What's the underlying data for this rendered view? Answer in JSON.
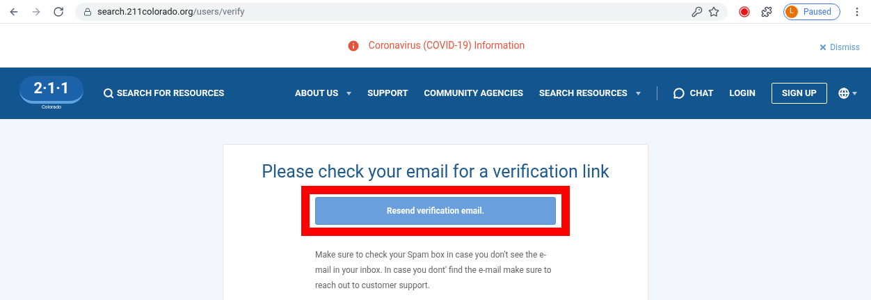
{
  "browser": {
    "url_host": "search.211colorado.org",
    "url_path": "/users/verify",
    "profile_initial": "L",
    "profile_status": "Paused"
  },
  "alert": {
    "text": "Coronavirus (COVID-19) Information",
    "dismiss": "Dismiss"
  },
  "nav": {
    "logo_text": "2·1·1",
    "logo_subtext": "Colorado",
    "search_link": "SEARCH FOR RESOURCES",
    "items": [
      {
        "label": "ABOUT US",
        "has_menu": true
      },
      {
        "label": "SUPPORT",
        "has_menu": false
      },
      {
        "label": "COMMUNITY AGENCIES",
        "has_menu": false
      },
      {
        "label": "SEARCH RESOURCES",
        "has_menu": true
      }
    ],
    "chat": "CHAT",
    "login": "LOGIN",
    "signup": "SIGN UP"
  },
  "card": {
    "heading": "Please check your email for a verification link",
    "button": "Resend verification email.",
    "highlighted": true,
    "note": "Make sure to check your Spam box in case you don't see the e-mail in your inbox. In case you dont' find the e-mail make sure to reach out to customer support."
  }
}
